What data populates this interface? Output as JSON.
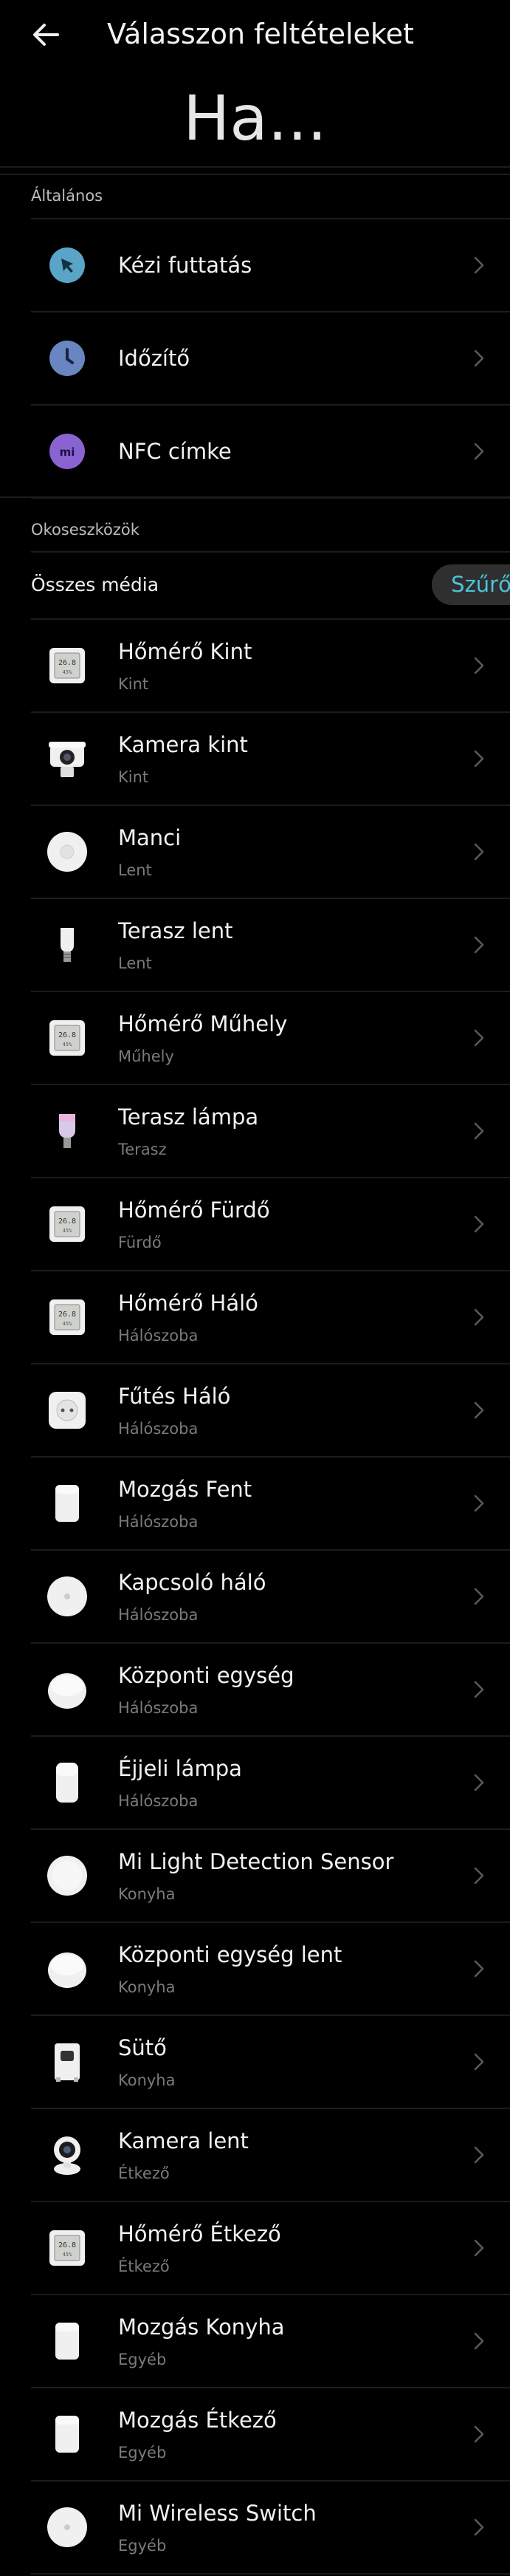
{
  "header": {
    "title": "Válasszon feltételeket",
    "subtitle": "Ha..."
  },
  "sections": {
    "general": "Általános",
    "smart": "Okoseszközök"
  },
  "general_items": [
    {
      "label": "Kézi futtatás",
      "icon": "manual-run-icon",
      "color": "#5aa4c8"
    },
    {
      "label": "Időzítő",
      "icon": "clock-icon",
      "color": "#6a86c0"
    },
    {
      "label": "NFC címke",
      "icon": "nfc-icon",
      "color": "#8a63d2"
    }
  ],
  "filter": {
    "all_label": "Összes média",
    "button": "Szűrő"
  },
  "devices": [
    {
      "name": "Hőmérő Kint",
      "room": "Kint",
      "icon": "thermometer-icon"
    },
    {
      "name": "Kamera kint",
      "room": "Kint",
      "icon": "outdoor-camera-icon"
    },
    {
      "name": "Manci",
      "room": "Lent",
      "icon": "vacuum-robot-icon"
    },
    {
      "name": "Terasz lent",
      "room": "Lent",
      "icon": "bulb-icon"
    },
    {
      "name": "Hőmérő Műhely",
      "room": "Műhely",
      "icon": "thermometer-icon"
    },
    {
      "name": "Terasz lámpa",
      "room": "Terasz",
      "icon": "color-bulb-icon"
    },
    {
      "name": "Hőmérő Fürdő",
      "room": "Fürdő",
      "icon": "thermometer-icon"
    },
    {
      "name": "Hőmérő Háló",
      "room": "Hálószoba",
      "icon": "thermometer-icon"
    },
    {
      "name": "Fűtés Háló",
      "room": "Hálószoba",
      "icon": "smart-plug-icon"
    },
    {
      "name": "Mozgás Fent",
      "room": "Hálószoba",
      "icon": "motion-sensor-icon"
    },
    {
      "name": "Kapcsoló háló",
      "room": "Hálószoba",
      "icon": "wireless-switch-icon"
    },
    {
      "name": "Központi egység",
      "room": "Hálószoba",
      "icon": "hub-icon"
    },
    {
      "name": "Éjjeli lámpa",
      "room": "Hálószoba",
      "icon": "night-lamp-icon"
    },
    {
      "name": "Mi Light Detection Sensor",
      "room": "Konyha",
      "icon": "light-sensor-icon"
    },
    {
      "name": "Központi egység lent",
      "room": "Konyha",
      "icon": "hub-icon"
    },
    {
      "name": "Sütő",
      "room": "Konyha",
      "icon": "oven-icon"
    },
    {
      "name": "Kamera lent",
      "room": "Étkező",
      "icon": "indoor-camera-icon"
    },
    {
      "name": "Hőmérő Étkező",
      "room": "Étkező",
      "icon": "thermometer-icon"
    },
    {
      "name": "Mozgás Konyha",
      "room": "Egyéb",
      "icon": "motion-sensor-icon"
    },
    {
      "name": "Mozgás Étkező",
      "room": "Egyéb",
      "icon": "motion-sensor-icon"
    },
    {
      "name": "Mi Wireless Switch",
      "room": "Egyéb",
      "icon": "wireless-switch-icon"
    }
  ]
}
